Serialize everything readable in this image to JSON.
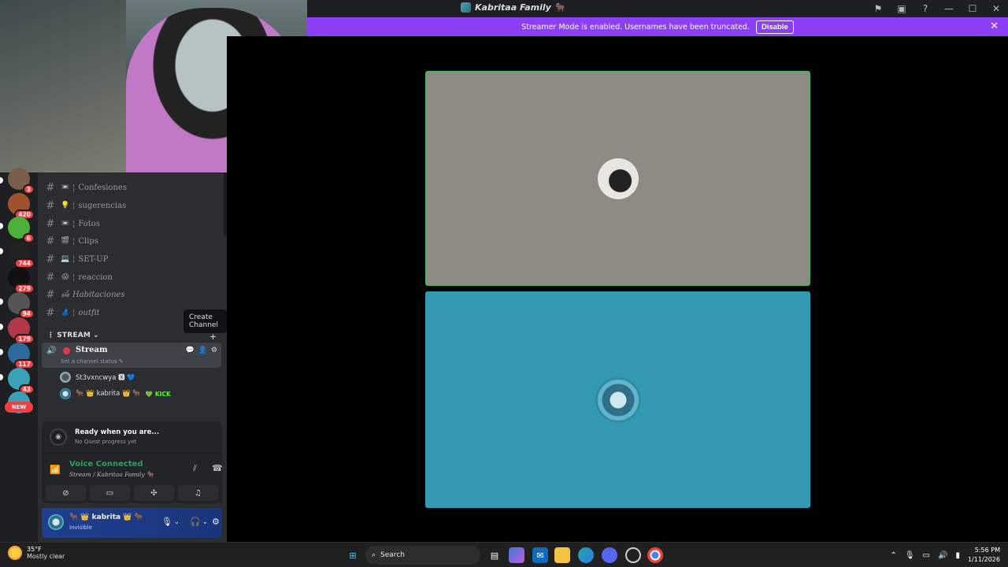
{
  "window": {
    "title": "Kabritaa Family 🐂",
    "actions": [
      "⚑",
      "▣",
      "?",
      "—",
      "☐",
      "✕"
    ]
  },
  "banner": {
    "text": "Streamer Mode is enabled. Usernames have been truncated.",
    "button": "Disable",
    "close": "✕"
  },
  "servers": [
    {
      "badge": "3",
      "color": "#7a5c4a"
    },
    {
      "badge": "420",
      "color": "#a0522d"
    },
    {
      "badge": "6",
      "color": "#4caf3a"
    },
    {
      "badge": "744",
      "color": "#222"
    },
    {
      "badge": "279",
      "color": "#111"
    },
    {
      "badge": "94",
      "color": "#555"
    },
    {
      "badge": "179",
      "color": "#b23a48"
    },
    {
      "badge": "117",
      "color": "#2a6b9c"
    },
    {
      "badge": "43",
      "color": "#3aa0b5"
    },
    {
      "badge": "",
      "color": "#3aa0b5"
    }
  ],
  "rail_new": "NEW",
  "channels": [
    {
      "emoji": "📼",
      "name": "Confesiones",
      "sep": true,
      "italic": false
    },
    {
      "emoji": "💡",
      "name": "sugerencias",
      "sep": true,
      "italic": false
    },
    {
      "emoji": "📼",
      "name": "Fotos",
      "sep": true,
      "italic": false
    },
    {
      "emoji": "🎬",
      "name": "Clips",
      "sep": true,
      "italic": false
    },
    {
      "emoji": "💻",
      "name": "SET-UP",
      "sep": true,
      "italic": false
    },
    {
      "emoji": "😱",
      "name": "reaccion",
      "sep": true,
      "italic": false
    },
    {
      "emoji": "🛋",
      "name": "Habitaciones",
      "sep": false,
      "italic": true
    },
    {
      "emoji": "👗",
      "name": "outfit",
      "sep": true,
      "italic": true
    }
  ],
  "category": {
    "name": "STREAM",
    "prefix": "⋮"
  },
  "tooltip": "Create Channel",
  "voice_channel": {
    "name": "Stream",
    "status": "Set a channel status ✎",
    "users": [
      {
        "name": "St3vxncwya 🆇 💙",
        "tag": ""
      },
      {
        "name": "🐂 👑 kabrita 👑 🐂",
        "tag": "💚 KICK"
      }
    ]
  },
  "quest": {
    "title": "Ready when you are...",
    "subtitle": "No Quest progress yet"
  },
  "voice": {
    "title": "Voice Connected",
    "location": "Stream / Kabritaa Family 🐂"
  },
  "user_panel": {
    "name": "🐂 👑 kabrita 👑 🐂",
    "status": "Invisible"
  },
  "taskbar": {
    "temp": "35°F",
    "weather": "Mostly clear",
    "search": "Search",
    "time": "5:56 PM",
    "date": "1/11/2026"
  }
}
